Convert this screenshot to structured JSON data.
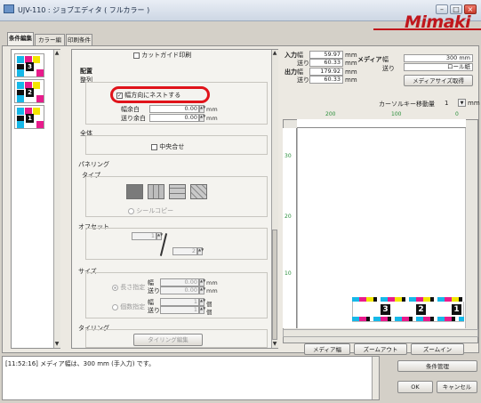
{
  "window": {
    "title": "UJV-110 : ジョブエディタ ( フルカラー )",
    "logo": "Mimaki"
  },
  "tabs": [
    {
      "label": "条件編集",
      "active": true
    },
    {
      "label": "カラー編集",
      "active": false
    },
    {
      "label": "印刷条件",
      "active": false
    }
  ],
  "jobs": [
    {
      "number": "3"
    },
    {
      "number": "2"
    },
    {
      "number": "1"
    }
  ],
  "settings": {
    "guide_print": "カットガイド印刷",
    "layout_label": "配置",
    "alignment_label": "整列",
    "nest_width_label": "幅方向にネストする",
    "nest_width_checked": true,
    "gap_width_label": "幅余白",
    "gap_width_value": "0.00",
    "gap_feed_label": "送り余白",
    "gap_feed_value": "0.00",
    "unit_mm": "mm",
    "whole_label": "全体",
    "center_label": "中央合せ",
    "paneling_label": "パネリング",
    "type_label": "タイプ",
    "seal_copy_label": "シールコピー",
    "offset_label": "オフセット",
    "offset_a": "1",
    "offset_b": "2",
    "size_label": "サイズ",
    "length_spec_label": "長さ指定",
    "count_spec_label": "個数指定",
    "width_label": "幅",
    "feed_label": "送り",
    "length_w": "0.00",
    "length_f": "0.00",
    "count_w": "1",
    "count_f": "1",
    "unit_count": "個",
    "tiling_label": "タイリング",
    "tiling_edit_button": "タイリング編集"
  },
  "info": {
    "input_label": "入力",
    "output_label": "出力",
    "width_label": "幅",
    "feed_label": "送り",
    "input_width": "59.97",
    "input_feed": "60.33",
    "output_width": "179.92",
    "output_feed": "60.33",
    "unit_mm": "mm",
    "media_label": "メディア",
    "media_width": "300 mm",
    "media_feed": "ロール紙",
    "media_size_button": "メディアサイズ取得",
    "cursor_step_label": "カーソルキー移動量",
    "cursor_step_value": "1",
    "cursor_step_unit": "mm"
  },
  "preview": {
    "ruler_top": [
      "200",
      "100",
      "0"
    ],
    "ruler_left": [
      "30",
      "20",
      "10"
    ],
    "copies": [
      "3",
      "2",
      "1"
    ],
    "media_width_button": "メディア幅",
    "zoom_out_button": "ズームアウト",
    "zoom_in_button": "ズームイン"
  },
  "status": {
    "message": "[11:52:16] メディア幅は、300 mm (手入力) です。",
    "condition_manage_button": "条件管理",
    "ok_button": "OK",
    "cancel_button": "キャンセル"
  }
}
